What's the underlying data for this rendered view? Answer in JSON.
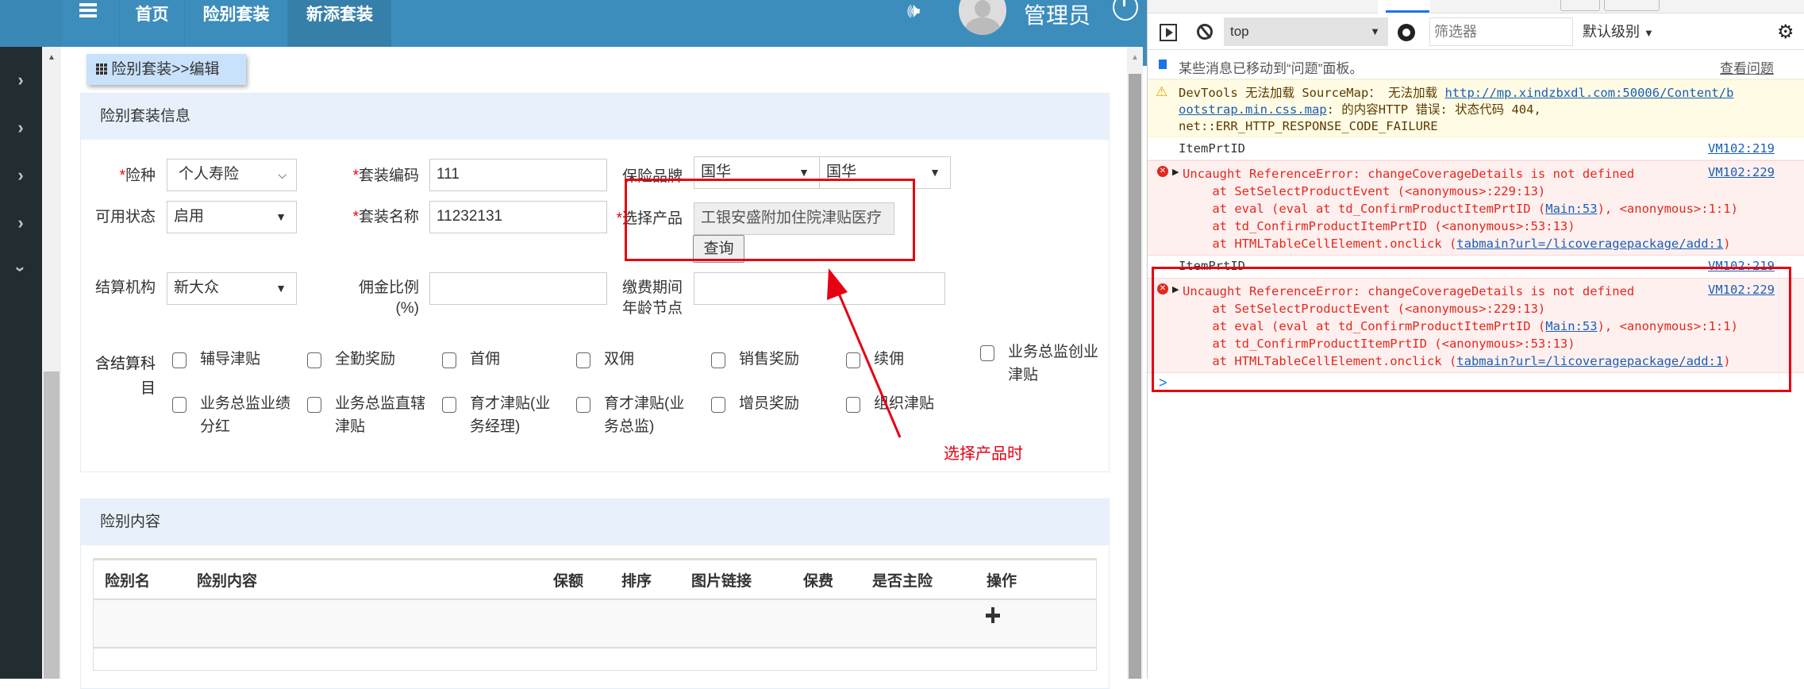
{
  "header": {
    "nav": [
      "首页",
      "险别套装",
      "新添套装"
    ],
    "user": "管理员"
  },
  "breadcrumb": "险别套装>>编辑",
  "info_panel": {
    "title": "险别套装信息",
    "fields": {
      "insurance_type": {
        "label": "险种",
        "value": "个人寿险"
      },
      "package_code": {
        "label": "套装编码",
        "value": "111"
      },
      "brand": {
        "label": "保险品牌",
        "value1": "国华",
        "value2": "国华"
      },
      "status": {
        "label": "可用状态",
        "value": "启用"
      },
      "package_name": {
        "label": "套装名称",
        "value": "11232131"
      },
      "product": {
        "label": "选择产品",
        "value": "工银安盛附加住院津贴医疗",
        "button": "查询"
      },
      "settlement_org": {
        "label": "结算机构",
        "value": "新大众"
      },
      "commission": {
        "label1": "佣金比例",
        "label2": "(%)",
        "value": ""
      },
      "age_node": {
        "label1": "缴费期间",
        "label2": "年龄节点",
        "value": ""
      }
    },
    "subjects": {
      "label1": "含结算科目",
      "label2": "目",
      "label1_short": "含结算科",
      "items": [
        "辅导津贴",
        "全勤奖励",
        "首佣",
        "双佣",
        "销售奖励",
        "续佣",
        "业务总监创业津贴",
        "业务总监业绩分红",
        "业务总监直辖津贴",
        "育才津贴(业务经理)",
        "育才津贴(业务总监)",
        "增员奖励",
        "组织津贴"
      ]
    }
  },
  "annotation": {
    "text": "选择产品时",
    "color": "#e60012"
  },
  "content_panel": {
    "title": "险别内容",
    "columns": [
      "险别名",
      "险别内容",
      "保额",
      "排序",
      "图片链接",
      "保费",
      "是否主险",
      "操作"
    ],
    "add_icon": "plus-icon"
  },
  "devtools": {
    "context": "top",
    "filter_placeholder": "筛选器",
    "level": "默认级别",
    "info_msg": "某些消息已移动到“问题”面板。",
    "info_link": "查看问题",
    "warning": {
      "l1a": "DevTools 无法加载 SourceMap： 无法加载 ",
      "l1link": "http://mp.xindzbxdl.com:50006/Content/b",
      "l2link": "ootstrap.min.css.map",
      "l2b": ": 的内容HTTP 错误: 状态代码 404,",
      "l3": "net::ERR_HTTP_RESPONSE_CODE_FAILURE"
    },
    "log1": {
      "text": "ItemPrtID",
      "src": "VM102:219"
    },
    "error1": {
      "msg": "Uncaught ReferenceError: changeCoverageDetails is not defined",
      "src": "VM102:229",
      "s1": "    at SetSelectProductEvent (<anonymous>:229:13)",
      "s2a": "    at eval (eval at td_ConfirmProductItemPrtID (",
      "s2link": "Main:53",
      "s2b": "), <anonymous>:1:1)",
      "s3": "    at td_ConfirmProductItemPrtID (<anonymous>:53:13)",
      "s4a": "    at HTMLTableCellElement.onclick (",
      "s4link": "tabmain?url=/licoveragepackage/add:1",
      "s4b": ")"
    },
    "log2": {
      "text": "ItemPrtID",
      "src": "VM102:219"
    },
    "prompt": ">"
  }
}
